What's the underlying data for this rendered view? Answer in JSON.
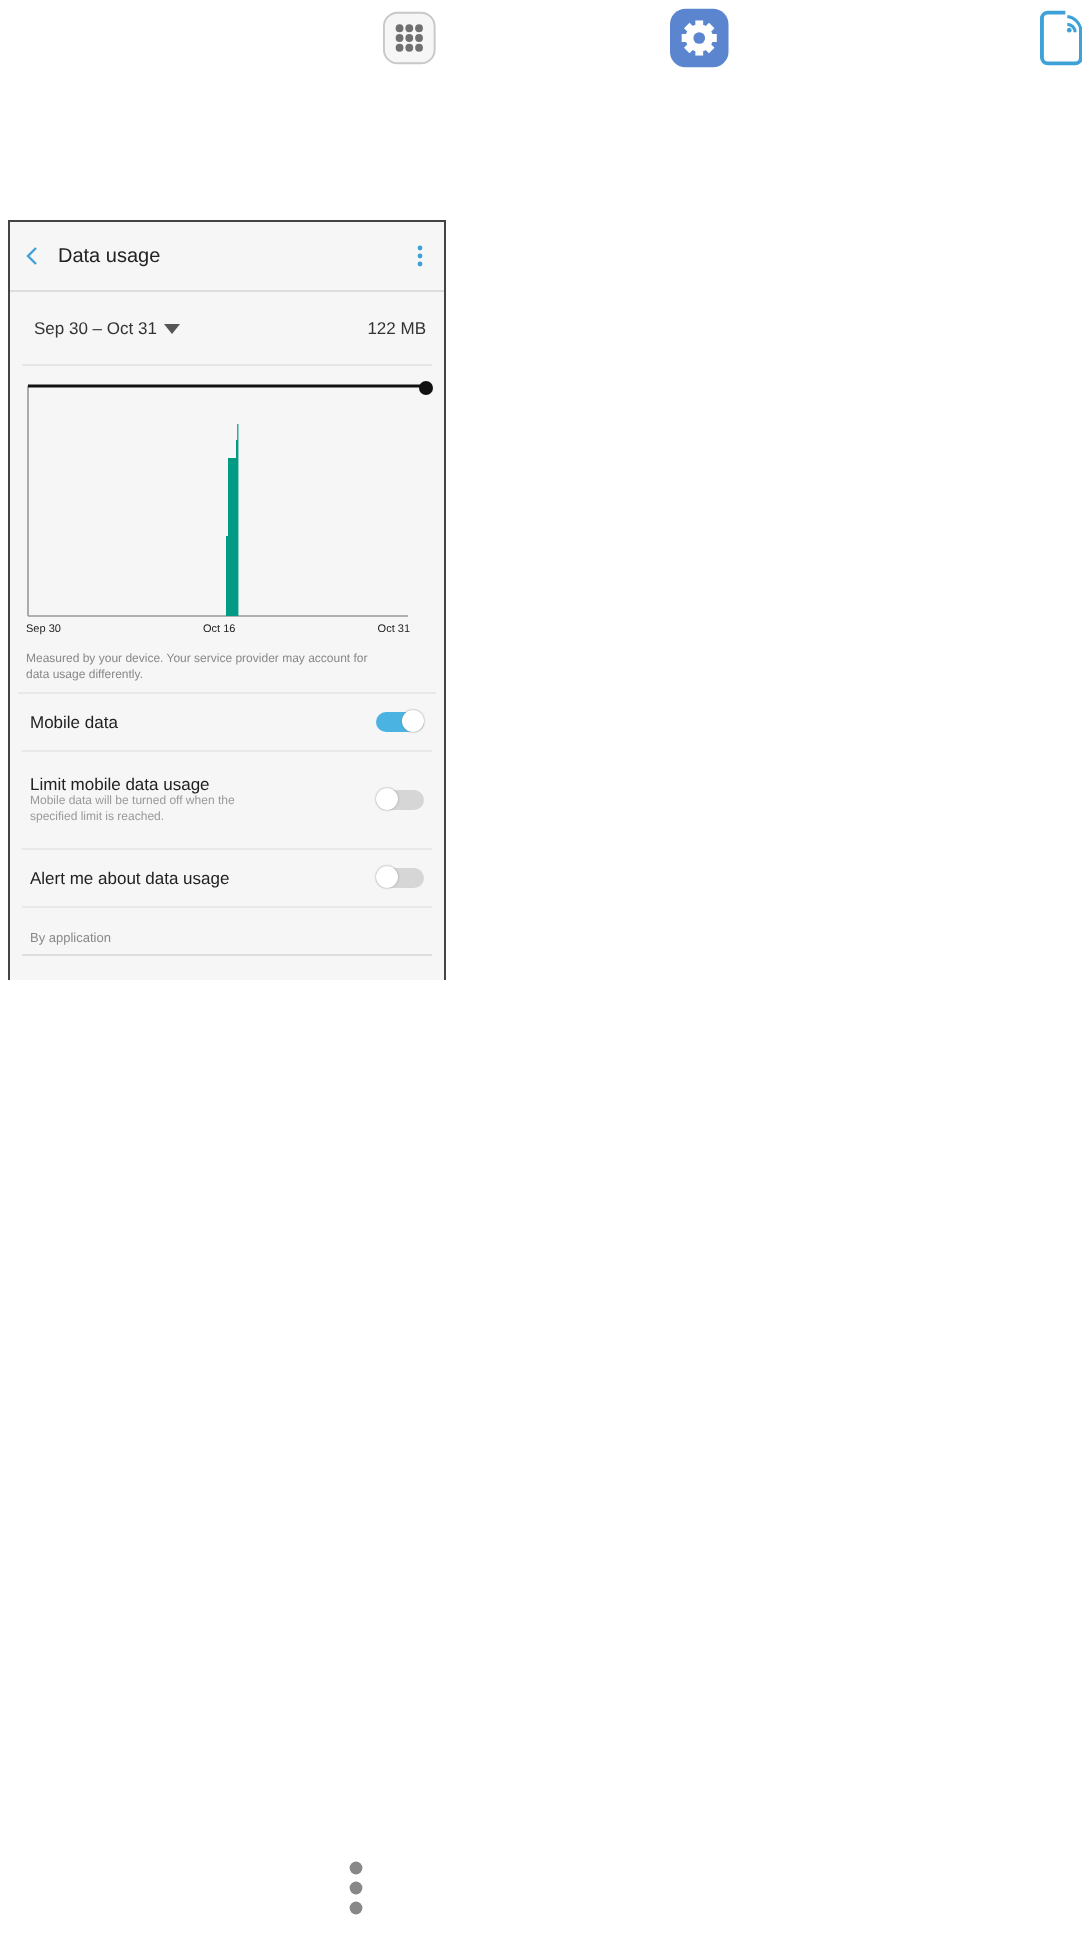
{
  "screen": {
    "title": "Data usage",
    "period": "Sep 30 – Oct 31",
    "total": "122 MB",
    "graph_labels": [
      "Sep 30",
      "Oct 16",
      "Oct 31"
    ],
    "note": "Measured by your device. Your service provider may account for data usage differently.",
    "settings": [
      {
        "label": "Mobile data",
        "on": true
      },
      {
        "label": "Limit mobile data usage",
        "description": "Mobile data will be turned off when the specified limit is reached.",
        "on": false
      },
      {
        "label": "Alert me about data usage",
        "on": false
      }
    ],
    "section": "By application"
  }
}
